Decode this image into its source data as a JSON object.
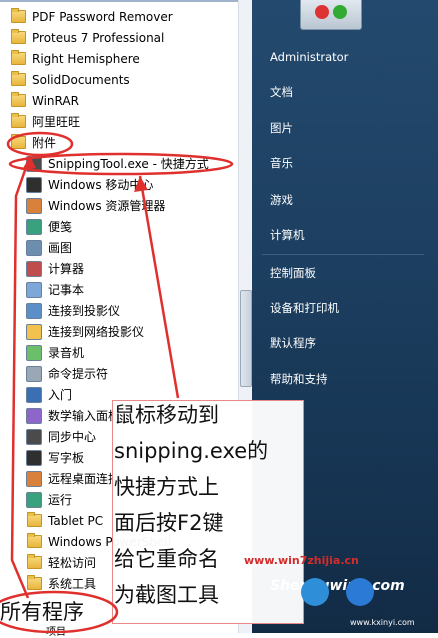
{
  "menu_items": [
    {
      "label": "PDF Password Remover",
      "icon": "folder-icon",
      "level": 0
    },
    {
      "label": "Proteus 7 Professional",
      "icon": "folder-icon",
      "level": 0
    },
    {
      "label": "Right Hemisphere",
      "icon": "folder-icon",
      "level": 0
    },
    {
      "label": "SolidDocuments",
      "icon": "folder-icon",
      "level": 0
    },
    {
      "label": "WinRAR",
      "icon": "folder-icon",
      "level": 0
    },
    {
      "label": "阿里旺旺",
      "icon": "folder-icon",
      "level": 0
    },
    {
      "label": "附件",
      "icon": "folder-icon",
      "level": 0
    },
    {
      "label": "SnippingTool.exe - 快捷方式",
      "icon": "scissors-icon",
      "level": 1
    },
    {
      "label": "Windows 移动中心",
      "icon": "mobility-center-icon",
      "level": 1
    },
    {
      "label": "Windows 资源管理器",
      "icon": "explorer-icon",
      "level": 1
    },
    {
      "label": "便笺",
      "icon": "sticky-note-icon",
      "level": 1
    },
    {
      "label": "画图",
      "icon": "paint-icon",
      "level": 1
    },
    {
      "label": "计算器",
      "icon": "calculator-icon",
      "level": 1
    },
    {
      "label": "记事本",
      "icon": "notepad-icon",
      "level": 1
    },
    {
      "label": "连接到投影仪",
      "icon": "projector-icon",
      "level": 1
    },
    {
      "label": "连接到网络投影仪",
      "icon": "network-projector-icon",
      "level": 1
    },
    {
      "label": "录音机",
      "icon": "microphone-icon",
      "level": 1
    },
    {
      "label": "命令提示符",
      "icon": "command-prompt-icon",
      "level": 1
    },
    {
      "label": "入门",
      "icon": "getting-started-icon",
      "level": 1
    },
    {
      "label": "数学输入面板",
      "icon": "math-input-icon",
      "level": 1
    },
    {
      "label": "同步中心",
      "icon": "sync-icon",
      "level": 1
    },
    {
      "label": "写字板",
      "icon": "wordpad-icon",
      "level": 1
    },
    {
      "label": "远程桌面连接",
      "icon": "remote-desktop-icon",
      "level": 1
    },
    {
      "label": "运行",
      "icon": "run-icon",
      "level": 1
    },
    {
      "label": "Tablet PC",
      "icon": "folder-icon",
      "level": 1
    },
    {
      "label": "Windows PowerShell",
      "icon": "folder-icon",
      "level": 1
    },
    {
      "label": "轻松访问",
      "icon": "folder-icon",
      "level": 1
    },
    {
      "label": "系统工具",
      "icon": "folder-icon",
      "level": 1
    }
  ],
  "right_panel": {
    "user": "Administrator",
    "links": [
      "文档",
      "图片",
      "音乐",
      "游戏",
      "计算机",
      "控制面板",
      "设备和打印机",
      "默认程序",
      "帮助和支持"
    ]
  },
  "annotation": {
    "lines": [
      "鼠标移动到",
      "snipping.exe的",
      "快捷方式上",
      "面后按F2键",
      "给它重命名",
      "为截图工具"
    ]
  },
  "all_programs": "所有程序",
  "watermark": "www.win7zhijia.cn",
  "logo": {
    "text": "Shenduwin8.com",
    "sub": "www.kxinyi.com"
  },
  "cut_text": "项目",
  "colors": {
    "highlight": "#e0302e",
    "panel": "#1d3f61"
  }
}
